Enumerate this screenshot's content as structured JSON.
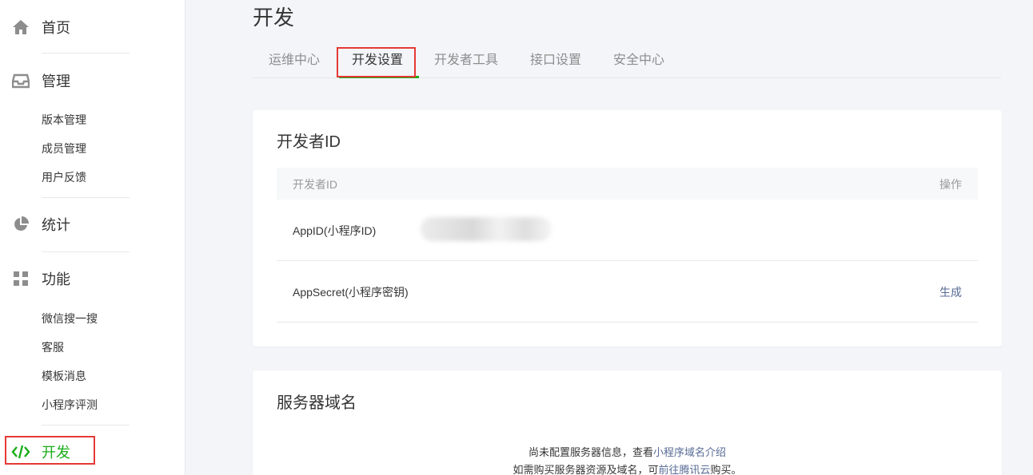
{
  "sidebar": {
    "home": "首页",
    "manage": "管理",
    "manage_items": [
      "版本管理",
      "成员管理",
      "用户反馈"
    ],
    "stats": "统计",
    "features": "功能",
    "feature_items": [
      "微信搜一搜",
      "客服",
      "模板消息",
      "小程序评测"
    ],
    "develop": "开发"
  },
  "main": {
    "title": "开发",
    "tabs": [
      "运维中心",
      "开发设置",
      "开发者工具",
      "接口设置",
      "安全中心"
    ],
    "active_tab": "开发设置"
  },
  "dev_id_card": {
    "title": "开发者ID",
    "header_col1": "开发者ID",
    "header_col2": "操作",
    "rows": [
      {
        "label": "AppID(小程序ID)",
        "action": ""
      },
      {
        "label": "AppSecret(小程序密钥)",
        "action": "生成"
      }
    ]
  },
  "server_card": {
    "title": "服务器域名",
    "line1_text": "尚未配置服务器信息，查看",
    "line1_link": "小程序域名介绍",
    "line2_text": "如需购买服务器资源及域名，可",
    "line2_link": "前往腾讯云",
    "line2_suffix": "购买。"
  },
  "colors": {
    "accent": "#1aad19",
    "link": "#576b95",
    "highlight": "#e53935"
  }
}
